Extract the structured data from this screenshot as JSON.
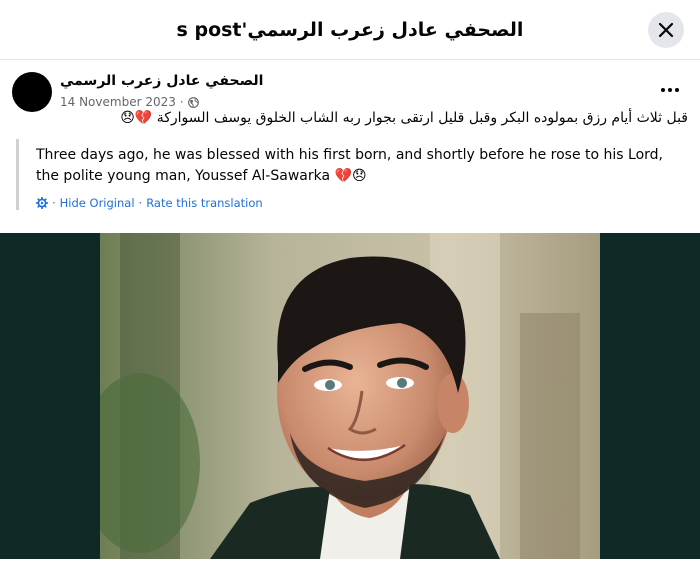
{
  "header": {
    "title": "s post'الصحفي عادل زعرب الرسمي"
  },
  "post": {
    "author": "الصحفي عادل زعرب الرسمي",
    "date": "14 November 2023",
    "separator": "·",
    "original_text": "قبل ثلاث أيام رزق بمولوده البكر وقبل قليل ارتقى بجوار ربه الشاب الخلوق يوسف السواركة",
    "original_emoji": "💔😞",
    "translation_text": "Three days ago, he was blessed with his first born, and shortly before he rose to his Lord, the polite young man, Youssef Al-Sawarka",
    "translation_emoji": "💔😞",
    "hide_original_label": "Hide Original",
    "link_separator": "·",
    "rate_translation_label": "Rate this translation"
  },
  "icons": {
    "close": "close-icon",
    "more": "more-icon",
    "globe": "globe-icon",
    "gear": "gear-icon"
  },
  "colors": {
    "link": "#216fdb",
    "meta": "#65676b",
    "image_background": "#0f2a26"
  }
}
